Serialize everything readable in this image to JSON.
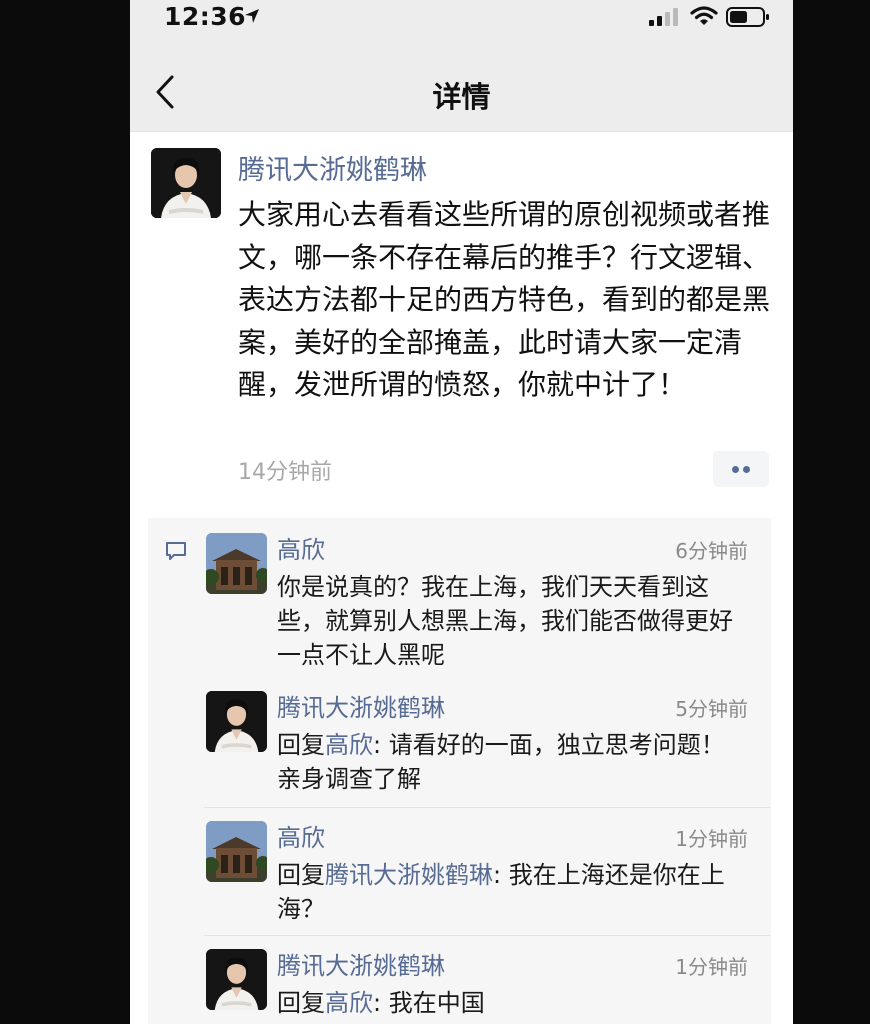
{
  "status_bar": {
    "time": "12:36"
  },
  "nav": {
    "title": "详情"
  },
  "post": {
    "author": "腾讯大浙姚鹤琳",
    "body": "大家用心去看看这些所谓的原创视频或者推文，哪一条不存在幕后的推手？行文逻辑、表达方法都十足的西方特色，看到的都是黑案，美好的全部掩盖，此时请大家一定清醒，发泄所谓的愤怒，你就中计了！",
    "time": "14分钟前"
  },
  "comments": [
    {
      "name": "高欣",
      "time": "6分钟前",
      "reply_prefix": "",
      "reply_to": "",
      "reply_sep": "",
      "text": "你是说真的？我在上海，我们天天看到这些，就算别人想黑上海，我们能否做得更好一点不让人黑呢"
    },
    {
      "name": "腾讯大浙姚鹤琳",
      "time": "5分钟前",
      "reply_prefix": "回复",
      "reply_to": "高欣",
      "reply_sep": ": ",
      "text": "请看好的一面，独立思考问题！亲身调查了解"
    },
    {
      "name": "高欣",
      "time": "1分钟前",
      "reply_prefix": "回复",
      "reply_to": "腾讯大浙姚鹤琳",
      "reply_sep": ": ",
      "text": "我在上海还是你在上海？"
    },
    {
      "name": "腾讯大浙姚鹤琳",
      "time": "1分钟前",
      "reply_prefix": "回复",
      "reply_to": "高欣",
      "reply_sep": ": ",
      "text": "我在中国"
    }
  ],
  "colors": {
    "link_blue": "#576b95",
    "nav_background": "#ededed",
    "comment_background": "#f6f6f6"
  },
  "icons": {
    "back": "chevron-left-icon",
    "location": "location-arrow-icon",
    "signal": "cellular-signal-icon",
    "wifi": "wifi-icon",
    "battery": "battery-icon",
    "comment": "comment-bubble-icon",
    "more": "more-dots-icon"
  }
}
